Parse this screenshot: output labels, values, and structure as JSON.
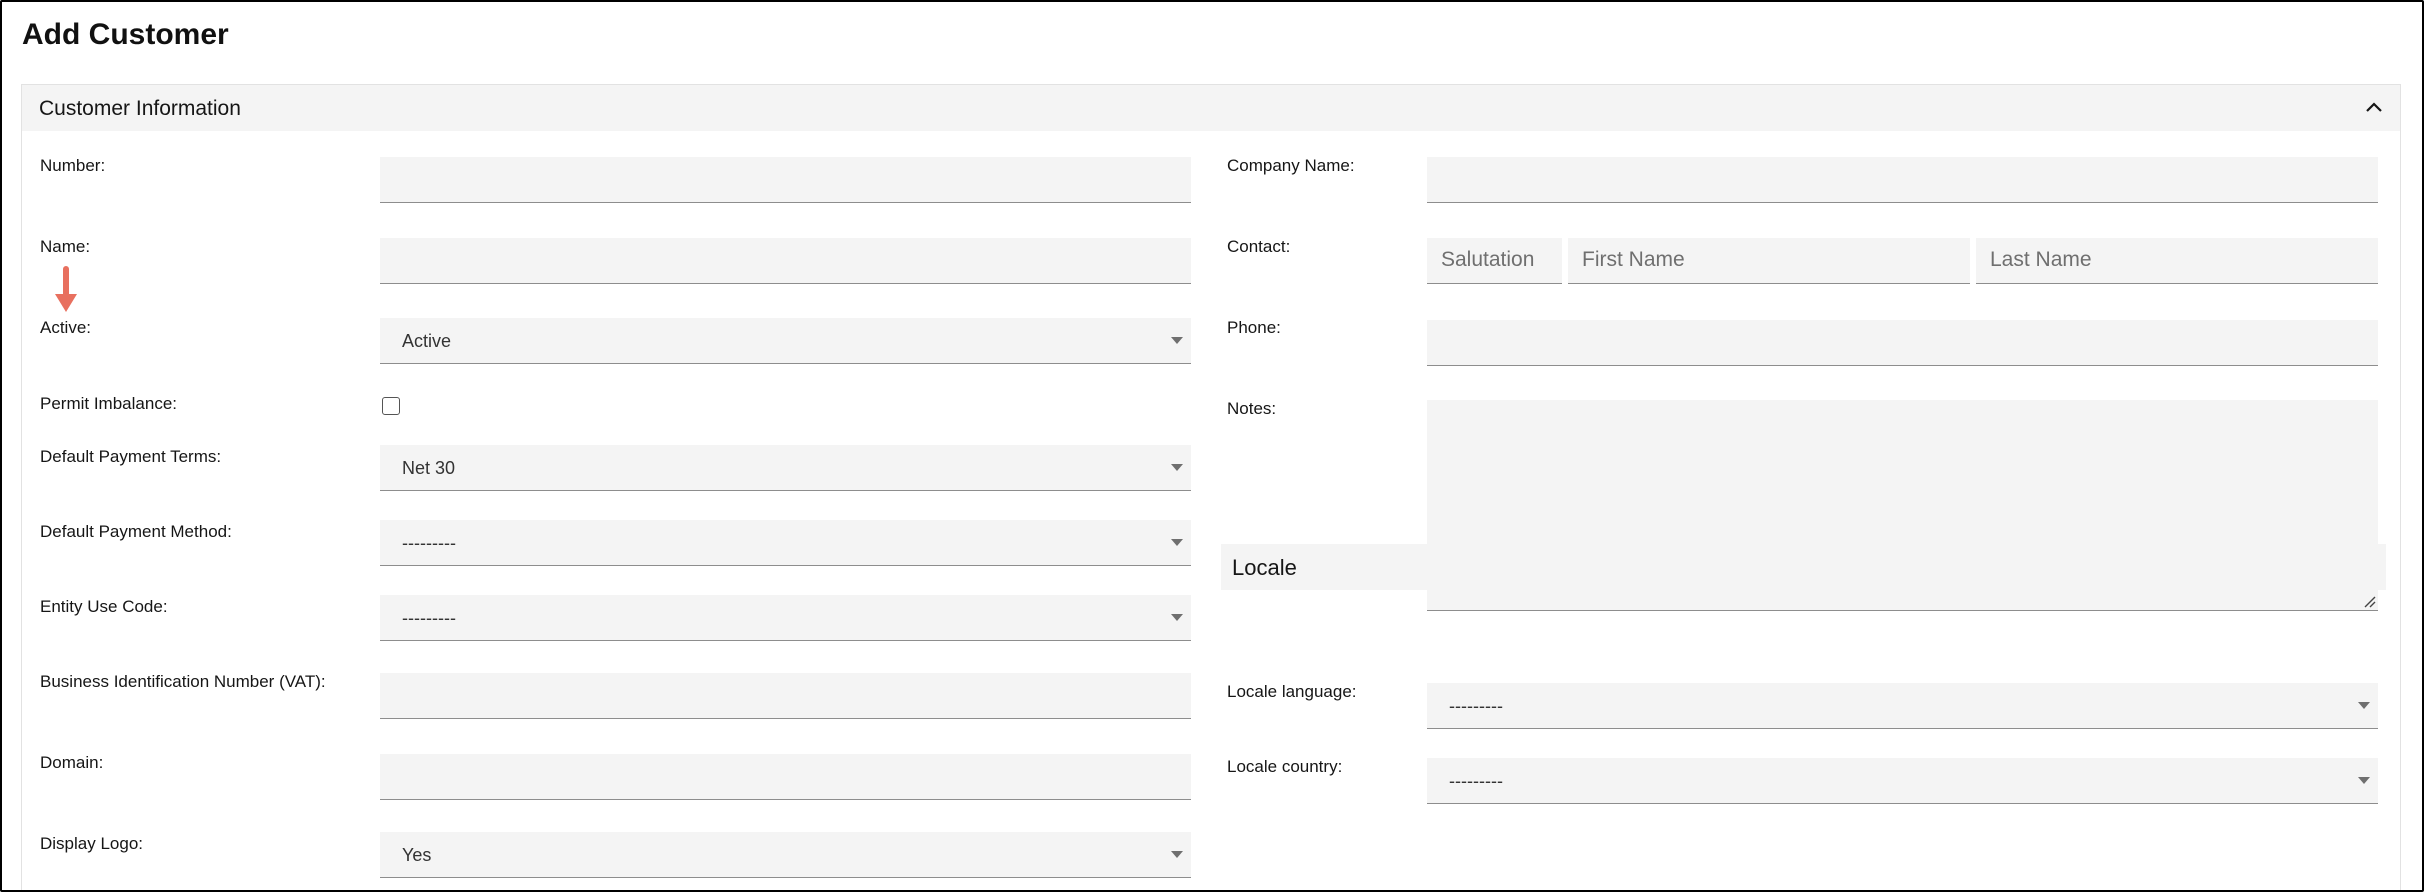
{
  "page": {
    "title": "Add Customer"
  },
  "section": {
    "title": "Customer Information"
  },
  "left": {
    "number_label": "Number:",
    "name_label": "Name:",
    "active_label": "Active:",
    "active_value": "Active",
    "permit_label": "Permit Imbalance:",
    "terms_label": "Default Payment Terms:",
    "terms_value": "Net 30",
    "method_label": "Default Payment Method:",
    "method_value": "---------",
    "entity_label": "Entity Use Code:",
    "entity_value": "---------",
    "vat_label": "Business Identification Number (VAT):",
    "domain_label": "Domain:",
    "logo_label": "Display Logo:",
    "logo_value": "Yes"
  },
  "right": {
    "company_label": "Company Name:",
    "contact_label": "Contact:",
    "salutation_placeholder": "Salutation",
    "first_placeholder": "First Name",
    "last_placeholder": "Last Name",
    "phone_label": "Phone:",
    "notes_label": "Notes:"
  },
  "locale": {
    "title": "Locale",
    "language_label": "Locale language:",
    "language_value": "---------",
    "country_label": "Locale country:",
    "country_value": "---------"
  },
  "colors": {
    "field_bg": "#f4f4f4",
    "annotation_arrow": "#e8705f"
  }
}
